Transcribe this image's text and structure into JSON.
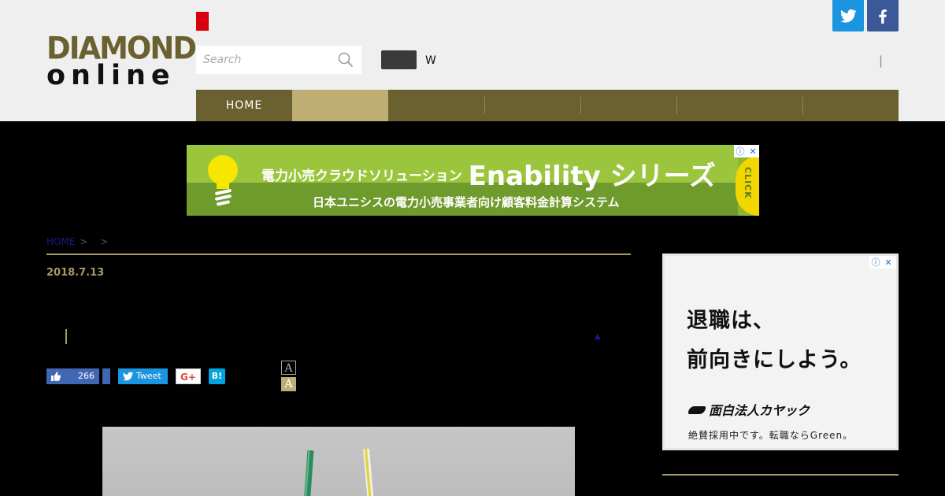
{
  "header": {
    "logo_top": "DIAMOND",
    "logo_bottom": "online",
    "search_placeholder": "Search",
    "w_label": "W",
    "pipe": "|",
    "social": [
      "twitter-icon",
      "facebook-icon"
    ]
  },
  "nav": {
    "items": [
      {
        "label": "HOME",
        "active": false
      },
      {
        "label": "",
        "active": true
      },
      {
        "label": "",
        "active": false
      },
      {
        "label": "",
        "active": false
      },
      {
        "label": "",
        "active": false
      },
      {
        "label": "",
        "active": false
      },
      {
        "label": "",
        "active": false
      }
    ]
  },
  "banner_ad": {
    "headline": "電力小売クラウドソリューション",
    "product": "Enability シリーズ",
    "subline": "日本ユニシスの電力小売事業者向け顧客料金計算システム",
    "click": "CLICK",
    "info": "ⓘ",
    "close": "✕"
  },
  "article": {
    "breadcrumb_home": "HOME",
    "breadcrumb_sep": ">",
    "date": "2018.7.13",
    "marker": "▲",
    "like_count": "266",
    "tweet_label": "Tweet",
    "gplus_label": "G+",
    "hatena_label": "B!",
    "font_small": "A",
    "font_large": "A"
  },
  "side_ad": {
    "line1": "退職は、",
    "line2": "前向きにしよう。",
    "brand": "面白法人カヤック",
    "note": "絶賛採用中です。転職ならGreen。",
    "info": "ⓘ",
    "close": "✕"
  },
  "colors": {
    "nav_bg": "#6b6130",
    "nav_active": "#bfae74",
    "accent_rule": "#a89b6a",
    "twitter": "#1b95e0",
    "facebook": "#3b5998",
    "red_mark": "#d7000f"
  }
}
